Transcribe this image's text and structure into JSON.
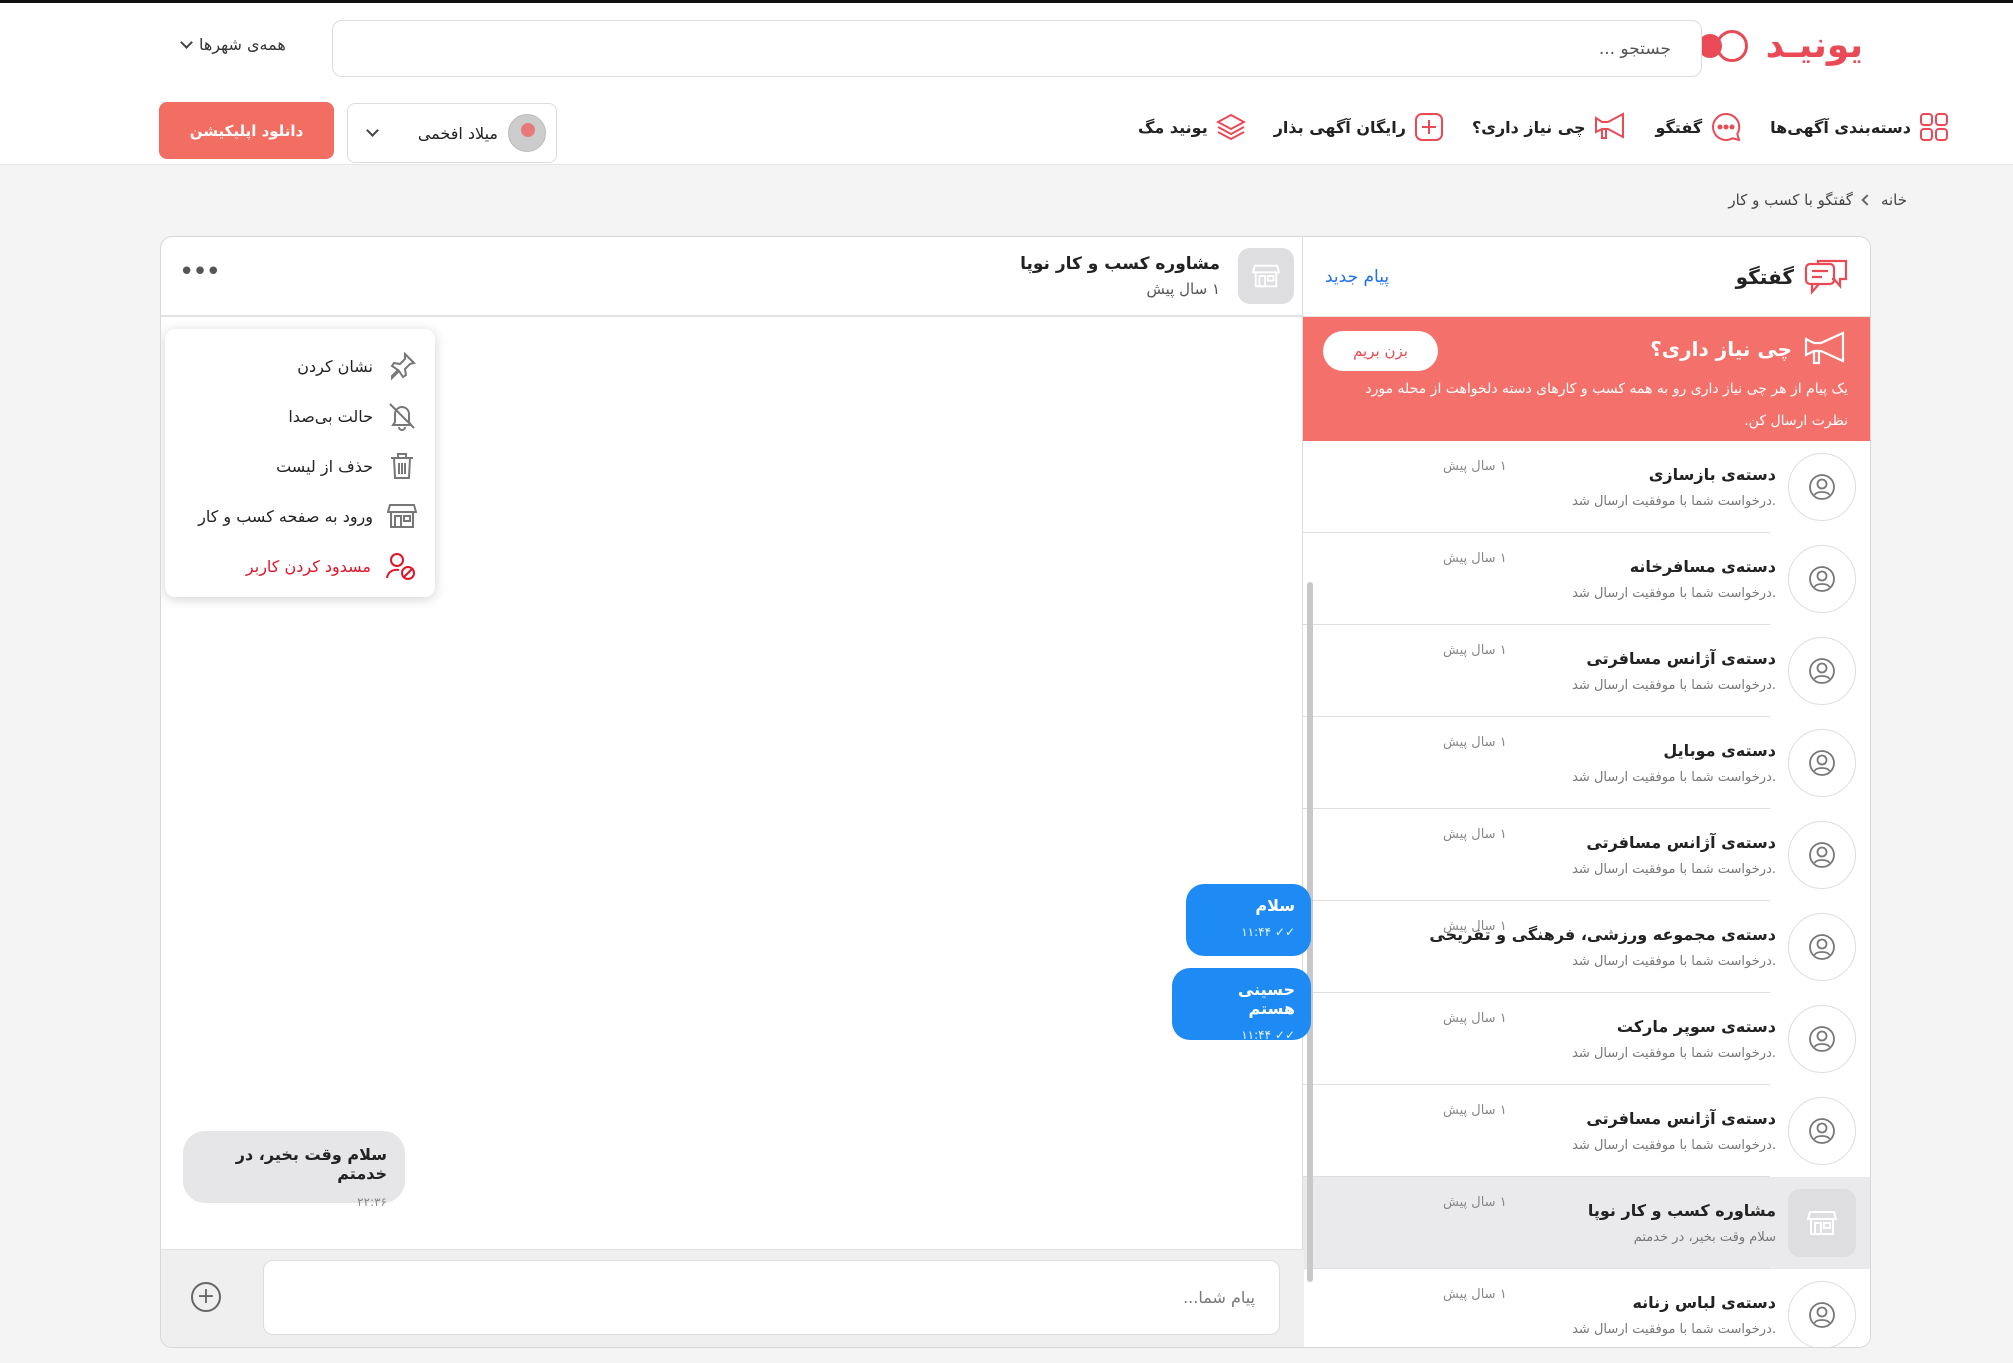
{
  "header": {
    "logo": "یونیـد",
    "search_placeholder": "جستجو ...",
    "city": "همه‌ی شهرها",
    "nav": [
      {
        "label": "دسته‌بندی آگهی‌ها",
        "icon": "grid-icon"
      },
      {
        "label": "گفتگو",
        "icon": "chat-bubble-icon"
      },
      {
        "label": "چی نیاز داری؟",
        "icon": "megaphone-icon"
      },
      {
        "label": "رایگان آگهی بذار",
        "icon": "plus-square-icon"
      },
      {
        "label": "یونید مگ",
        "icon": "layers-icon"
      }
    ],
    "user_name": "میلاد افخمی",
    "download_label": "دانلود اپلیکیشن"
  },
  "breadcrumb": {
    "home": "خانه",
    "current": "گفتگو با کسب و کار"
  },
  "list": {
    "title": "گفتگو",
    "new_message": "پیام جدید",
    "promo": {
      "title": "چی نیاز داری؟",
      "text": "یک پیام از هر چی نیاز داری رو به همه کسب و کارهای دسته دلخواهت از محله مورد نظرت ارسال کن.",
      "button": "بزن بریم"
    },
    "conversations": [
      {
        "name": "دسته‌ی بازسازی",
        "last": ".درخواست شما با موفقیت ارسال شد",
        "time": "۱ سال پیش"
      },
      {
        "name": "دسته‌ی مسافرخانه",
        "last": ".درخواست شما با موفقیت ارسال شد",
        "time": "۱ سال پیش"
      },
      {
        "name": "دسته‌ی آژانس مسافرتی",
        "last": ".درخواست شما با موفقیت ارسال شد",
        "time": "۱ سال پیش"
      },
      {
        "name": "دسته‌ی موبایل",
        "last": ".درخواست شما با موفقیت ارسال شد",
        "time": "۱ سال پیش"
      },
      {
        "name": "دسته‌ی آژانس مسافرتی",
        "last": ".درخواست شما با موفقیت ارسال شد",
        "time": "۱ سال پیش"
      },
      {
        "name": "دسته‌ی مجموعه ورزشی، فرهنگی و تفریحی",
        "last": ".درخواست شما با موفقیت ارسال شد",
        "time": "۱ سال پیش"
      },
      {
        "name": "دسته‌ی سوپر مارکت",
        "last": ".درخواست شما با موفقیت ارسال شد",
        "time": "۱ سال پیش"
      },
      {
        "name": "دسته‌ی آژانس مسافرتی",
        "last": ".درخواست شما با موفقیت ارسال شد",
        "time": "۱ سال پیش"
      },
      {
        "name": "مشاوره کسب و کار نوپا",
        "last": "سلام وقت بخیر، در خدمتم",
        "time": "۱ سال پیش"
      },
      {
        "name": "دسته‌ی لباس زنانه",
        "last": ".درخواست شما با موفقیت ارسال شد",
        "time": "۱ سال پیش"
      }
    ]
  },
  "chat": {
    "title": "مشاوره کسب و کار نوپا",
    "subtitle": "۱ سال پیش",
    "menu": [
      {
        "label": "نشان کردن",
        "icon": "pin-icon"
      },
      {
        "label": "حالت بی‌صدا",
        "icon": "bell-off-icon"
      },
      {
        "label": "حذف از لیست",
        "icon": "trash-icon"
      },
      {
        "label": "ورود به صفحه کسب و کار",
        "icon": "shop-icon"
      },
      {
        "label": "مسدود کردن کاربر",
        "icon": "block-user-icon"
      }
    ],
    "messages": [
      {
        "text": "سلام",
        "time": "۱۱:۴۴"
      },
      {
        "text": "حسینی هستم",
        "time": "۱۱:۴۴"
      },
      {
        "text": "سلام وقت بخیر، در خدمتم",
        "time": "۲۲:۳۶"
      }
    ],
    "composer_placeholder": "پیام شما..."
  },
  "colors": {
    "brand": "#e94a55",
    "promo": "#f4706a",
    "outgoing": "#1e8bf5",
    "link": "#1e6ef0",
    "danger": "#e0152a"
  }
}
